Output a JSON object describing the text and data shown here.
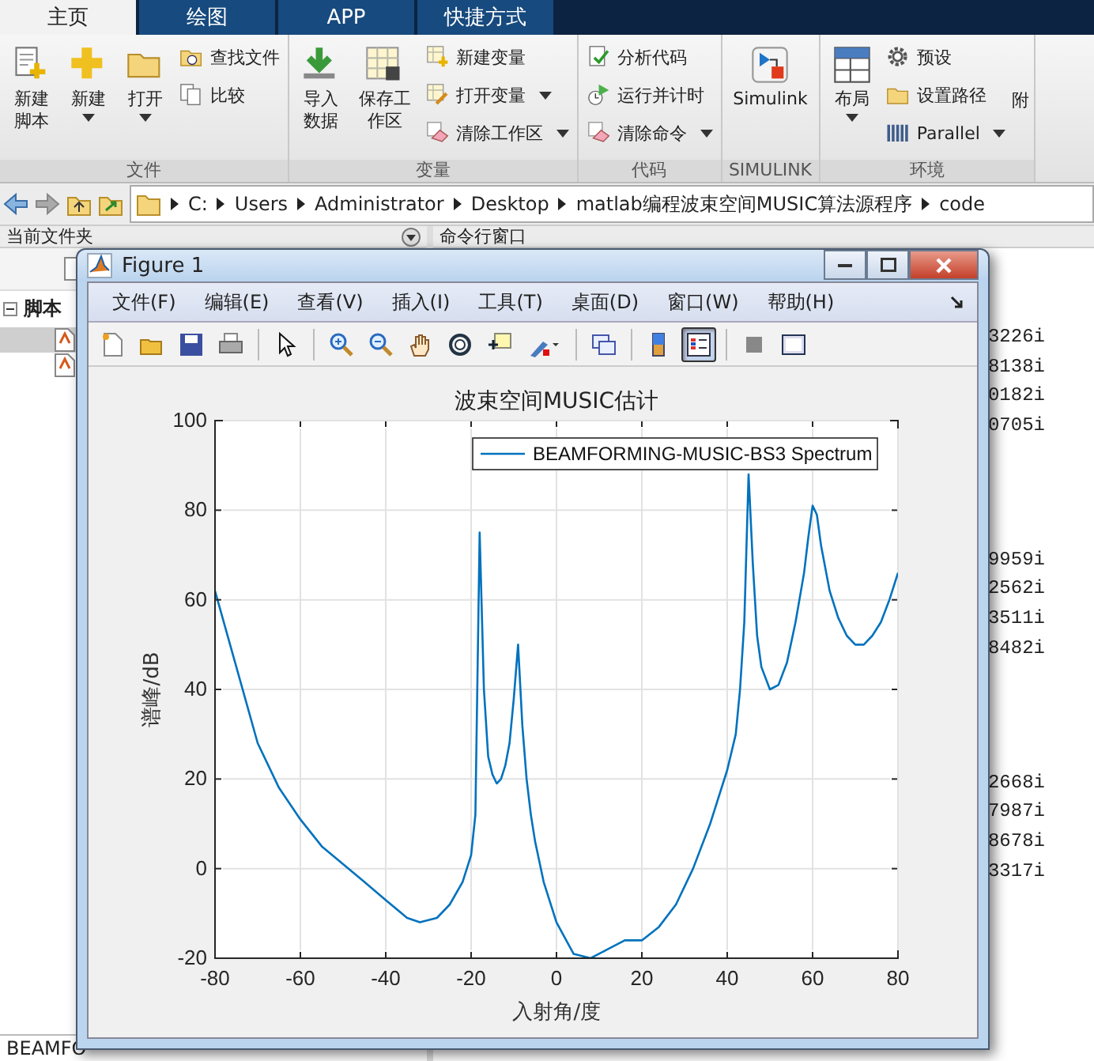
{
  "tabs": [
    {
      "label": "主页",
      "selected": true
    },
    {
      "label": "绘图",
      "selected": false
    },
    {
      "label": "APP",
      "selected": false
    },
    {
      "label": "快捷方式",
      "selected": false
    }
  ],
  "ribbon": [
    {
      "label": "文件",
      "columns": [
        [
          {
            "kind": "large",
            "label": "新建脚本",
            "menu": false
          }
        ],
        [
          {
            "kind": "large",
            "label": "新建",
            "menu": true
          }
        ],
        [
          {
            "kind": "large",
            "label": "打开",
            "menu": true
          }
        ],
        [
          {
            "kind": "small",
            "label": "查找文件",
            "menu": false
          },
          {
            "kind": "small",
            "label": "比较",
            "menu": false
          }
        ]
      ]
    },
    {
      "label": "变量",
      "columns": [
        [
          {
            "kind": "large",
            "label": "导入数据",
            "menu": false
          }
        ],
        [
          {
            "kind": "large",
            "label": "保存工作区",
            "menu": false
          }
        ],
        [
          {
            "kind": "small",
            "label": "新建变量",
            "menu": false
          },
          {
            "kind": "small",
            "label": "打开变量",
            "menu": true
          },
          {
            "kind": "small",
            "label": "清除工作区",
            "menu": true
          }
        ]
      ]
    },
    {
      "label": "代码",
      "columns": [
        [
          {
            "kind": "small",
            "label": "分析代码",
            "menu": false
          },
          {
            "kind": "small",
            "label": "运行并计时",
            "menu": false
          },
          {
            "kind": "small",
            "label": "清除命令",
            "menu": true
          }
        ]
      ]
    },
    {
      "label": "SIMULINK",
      "columns": [
        [
          {
            "kind": "large",
            "label": "Simulink",
            "menu": false
          }
        ]
      ]
    },
    {
      "label": "环境",
      "columns": [
        [
          {
            "kind": "large",
            "label": "布局",
            "menu": true
          }
        ],
        [
          {
            "kind": "small",
            "label": "预设",
            "menu": false
          },
          {
            "kind": "small",
            "label": "设置路径",
            "menu": false
          },
          {
            "kind": "small",
            "label": "Parallel",
            "menu": true
          }
        ],
        [
          {
            "kind": "cut",
            "label": "附",
            "menu": false
          }
        ]
      ]
    }
  ],
  "path": [
    "C:",
    "Users",
    "Administrator",
    "Desktop",
    "matlab编程波束空间MUSIC算法源程序",
    "code"
  ],
  "current_folder": {
    "title": "当前文件夹",
    "tree": {
      "label": "脚本",
      "expanded": true,
      "items": [
        {
          "selected": true
        },
        {
          "selected": false
        }
      ]
    },
    "footer": "BEAMFO"
  },
  "command_window": {
    "title": "命令行窗口",
    "blocks": [
      [
        "3226i",
        "8138i",
        "0182i",
        "0705i"
      ],
      [
        "9959i",
        "2562i",
        "3511i",
        "8482i"
      ],
      [
        "2668i",
        "7987i",
        "8678i",
        "3317i"
      ]
    ]
  },
  "figure": {
    "title": "Figure 1",
    "menus": [
      "文件(F)",
      "编辑(E)",
      "查看(V)",
      "插入(I)",
      "工具(T)",
      "桌面(D)",
      "窗口(W)",
      "帮助(H)"
    ],
    "toolbar": [
      {
        "kind": "new",
        "on": false
      },
      {
        "kind": "open",
        "on": false
      },
      {
        "kind": "save",
        "on": false
      },
      {
        "kind": "print",
        "on": false
      },
      {
        "kind": "separator"
      },
      {
        "kind": "pointer",
        "on": false
      },
      {
        "kind": "separator"
      },
      {
        "kind": "zoom-in",
        "on": false
      },
      {
        "kind": "zoom-out",
        "on": false
      },
      {
        "kind": "pan",
        "on": false
      },
      {
        "kind": "rotate",
        "on": false
      },
      {
        "kind": "datatip",
        "on": false
      },
      {
        "kind": "brush",
        "on": false
      },
      {
        "kind": "separator"
      },
      {
        "kind": "link",
        "on": false
      },
      {
        "kind": "separator"
      },
      {
        "kind": "colorbar",
        "on": false
      },
      {
        "kind": "legend",
        "on": true
      },
      {
        "kind": "separator"
      },
      {
        "kind": "hide",
        "on": false
      },
      {
        "kind": "dock",
        "on": false
      }
    ],
    "chart_data": {
      "type": "line",
      "title": "波束空间MUSIC估计",
      "xlabel": "入射角/度",
      "ylabel": "谱峰/dB",
      "grid": true,
      "xlim": [
        -80,
        80
      ],
      "ylim": [
        -20,
        100
      ],
      "xticks": [
        -80,
        -60,
        -40,
        -20,
        0,
        20,
        40,
        60,
        80
      ],
      "yticks": [
        -20,
        0,
        20,
        40,
        60,
        80,
        100
      ],
      "x": [
        -80,
        -75,
        -70,
        -65,
        -60,
        -55,
        -50,
        -45,
        -40,
        -35,
        -32,
        -28,
        -25,
        -22,
        -20,
        -19,
        -18,
        -17,
        -16,
        -15,
        -14,
        -13,
        -12,
        -11,
        -10,
        -9,
        -8,
        -7,
        -6,
        -5,
        -3,
        0,
        4,
        8,
        12,
        16,
        20,
        24,
        28,
        32,
        36,
        40,
        42,
        43,
        44,
        45,
        46,
        47,
        48,
        50,
        52,
        54,
        56,
        58,
        59,
        60,
        61,
        62,
        64,
        66,
        68,
        70,
        72,
        74,
        76,
        78,
        80
      ],
      "series": [
        {
          "name": "BEAMFORMING-MUSIC-BS3 Spectrum",
          "color": "#0072bd",
          "values": [
            62,
            45,
            28,
            18,
            11,
            5,
            1,
            -3,
            -7,
            -11,
            -12,
            -11,
            -8,
            -3,
            3,
            12,
            75,
            40,
            25,
            21,
            19,
            20,
            23,
            28,
            38,
            50,
            32,
            20,
            12,
            6,
            -3,
            -12,
            -19,
            -20,
            -18,
            -16,
            -16,
            -13,
            -8,
            0,
            10,
            22,
            30,
            40,
            55,
            88,
            68,
            52,
            45,
            40,
            41,
            46,
            55,
            66,
            74,
            81,
            79,
            72,
            62,
            56,
            52,
            50,
            50,
            52,
            55,
            60,
            66
          ]
        }
      ]
    }
  }
}
